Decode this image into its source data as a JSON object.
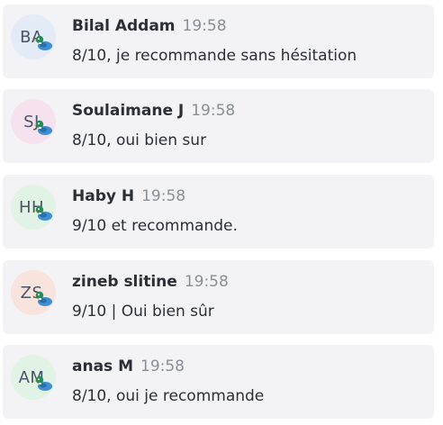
{
  "messages": [
    {
      "initials": "BA",
      "author": "Bilal Addam",
      "time": "19:58",
      "text": "8/10, je recommande sans hésitation",
      "avatar_color": "#e3ebf7"
    },
    {
      "initials": "SJ",
      "author": "Soulaimane J",
      "time": "19:58",
      "text": "8/10, oui bien sur",
      "avatar_color": "#f6e2ee"
    },
    {
      "initials": "HH",
      "author": "Haby H",
      "time": "19:58",
      "text": "9/10 et recommande.",
      "avatar_color": "#e1f3e4"
    },
    {
      "initials": "ZS",
      "author": "zineb slitine",
      "time": "19:58",
      "text": "9/10 | Oui bien sûr",
      "avatar_color": "#f8e3dd"
    },
    {
      "initials": "AM",
      "author": "anas M",
      "time": "19:58",
      "text": "8/10, oui je recommande",
      "avatar_color": "#e1f3e4"
    }
  ],
  "badge_icon": "duck-badge-icon"
}
